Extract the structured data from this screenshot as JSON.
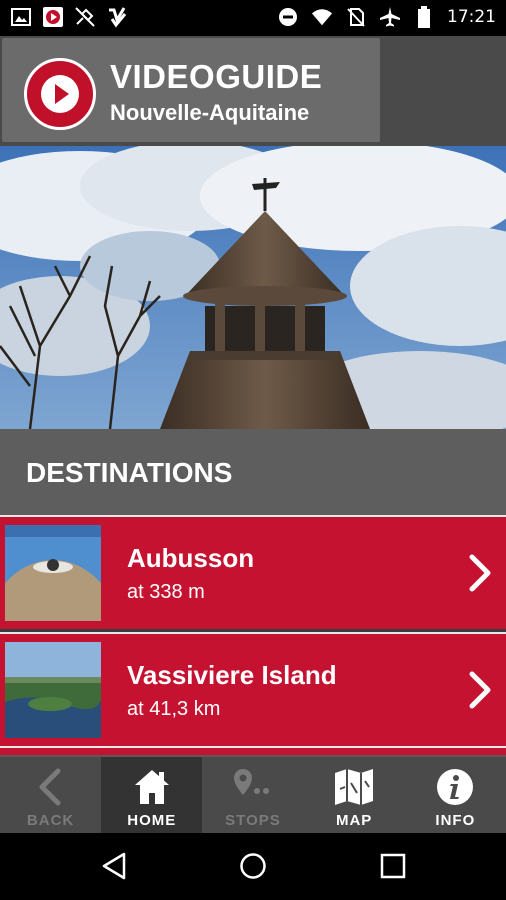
{
  "status_bar": {
    "time": "17:21",
    "left_icons": [
      "image-icon",
      "videoguide-app-icon",
      "no-satellite-icon",
      "checkmark-app-icon"
    ],
    "right_icons": [
      "do-not-disturb-icon",
      "wifi-icon",
      "no-sim-icon",
      "airplane-icon",
      "battery-icon"
    ]
  },
  "header": {
    "app_title": "VIDEOGUIDE",
    "region": "Nouvelle-Aquitaine"
  },
  "hero": {
    "description_icon": "bell-tower-image"
  },
  "destinations": {
    "title": "DESTINATIONS",
    "items": [
      {
        "name": "Aubusson",
        "distance": "at 338 m"
      },
      {
        "name": "Vassiviere Island",
        "distance": "at 41,3 km"
      }
    ]
  },
  "nav": {
    "items": [
      {
        "label": "BACK",
        "icon": "back-arrow-icon",
        "state": "disabled"
      },
      {
        "label": "HOME",
        "icon": "home-icon",
        "state": "active"
      },
      {
        "label": "STOPS",
        "icon": "stops-icon",
        "state": "disabled"
      },
      {
        "label": "MAP",
        "icon": "map-icon",
        "state": "enabled"
      },
      {
        "label": "INFO",
        "icon": "info-icon",
        "state": "enabled"
      }
    ]
  },
  "colors": {
    "accent": "#c41230",
    "header": "#4a4a4a",
    "section": "#5e5e5e"
  }
}
